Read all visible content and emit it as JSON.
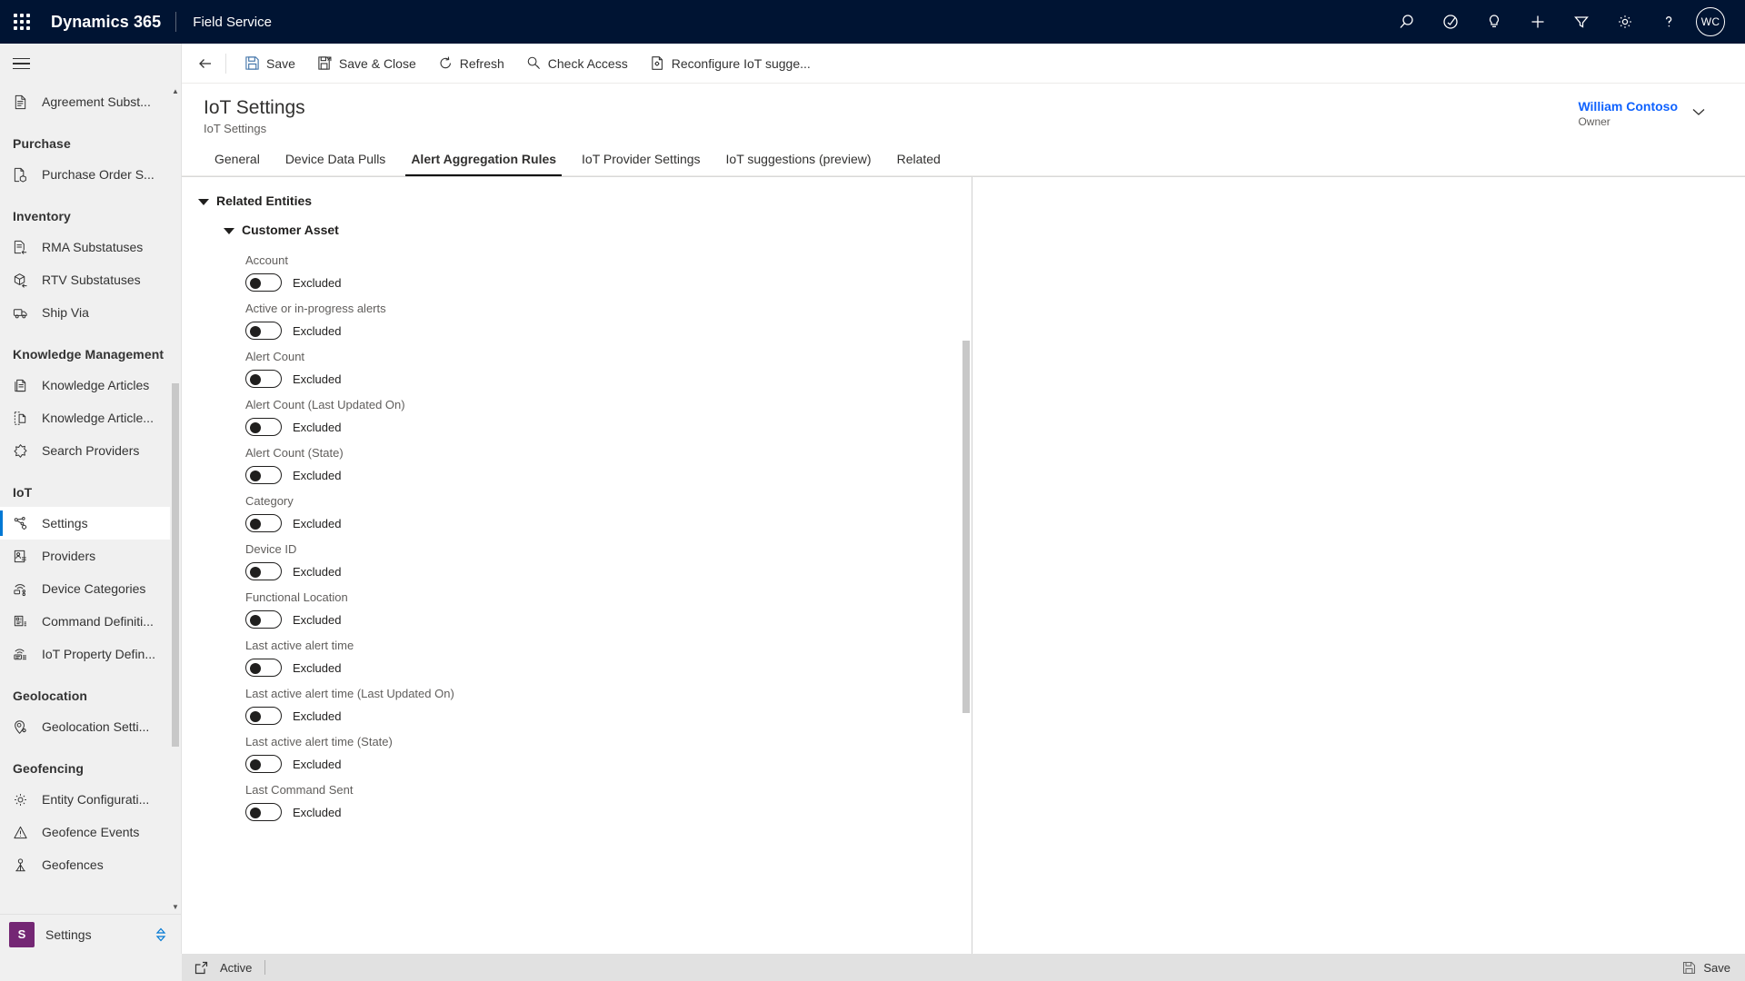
{
  "appbar": {
    "waffle_icon": "app-launcher-icon",
    "brand": "Dynamics 365",
    "app_name": "Field Service",
    "icons": [
      {
        "name": "search-icon",
        "label": "Search"
      },
      {
        "name": "assistant-icon",
        "label": "Assistant"
      },
      {
        "name": "lightbulb-icon",
        "label": "Insights"
      },
      {
        "name": "plus-icon",
        "label": "Quick create"
      },
      {
        "name": "filter-icon",
        "label": "Filter"
      },
      {
        "name": "gear-icon",
        "label": "Settings"
      },
      {
        "name": "help-icon",
        "label": "Help"
      }
    ],
    "avatar_initials": "WC"
  },
  "sidebar": {
    "hamburger_label": "Expand navigation",
    "groups": [
      {
        "title": "",
        "items": [
          {
            "label": "Agreement Subst...",
            "icon": "document-icon",
            "selected": false
          }
        ]
      },
      {
        "title": "Purchase",
        "items": [
          {
            "label": "Purchase Order S...",
            "icon": "purchase-order-icon",
            "selected": false
          }
        ]
      },
      {
        "title": "Inventory",
        "items": [
          {
            "label": "RMA Substatuses",
            "icon": "rma-icon",
            "selected": false
          },
          {
            "label": "RTV Substatuses",
            "icon": "rtv-icon",
            "selected": false
          },
          {
            "label": "Ship Via",
            "icon": "truck-icon",
            "selected": false
          }
        ]
      },
      {
        "title": "Knowledge Management",
        "items": [
          {
            "label": "Knowledge Articles",
            "icon": "knowledge-article-icon",
            "selected": false
          },
          {
            "label": "Knowledge Article...",
            "icon": "knowledge-template-icon",
            "selected": false
          },
          {
            "label": "Search Providers",
            "icon": "search-provider-icon",
            "selected": false
          }
        ]
      },
      {
        "title": "IoT",
        "items": [
          {
            "label": "Settings",
            "icon": "iot-settings-icon",
            "selected": true
          },
          {
            "label": "Providers",
            "icon": "iot-provider-icon",
            "selected": false
          },
          {
            "label": "Device Categories",
            "icon": "device-category-icon",
            "selected": false
          },
          {
            "label": "Command Definiti...",
            "icon": "command-definition-icon",
            "selected": false
          },
          {
            "label": "IoT Property Defin...",
            "icon": "iot-property-icon",
            "selected": false
          }
        ]
      },
      {
        "title": "Geolocation",
        "items": [
          {
            "label": "Geolocation Setti...",
            "icon": "geolocation-icon",
            "selected": false
          }
        ]
      },
      {
        "title": "Geofencing",
        "items": [
          {
            "label": "Entity Configurati...",
            "icon": "gear-icon",
            "selected": false
          },
          {
            "label": "Geofence Events",
            "icon": "warning-icon",
            "selected": false
          },
          {
            "label": "Geofences",
            "icon": "geofence-icon",
            "selected": false
          }
        ]
      }
    ],
    "footer": {
      "badge": "S",
      "label": "Settings",
      "chevron_icon": "area-switcher-icon"
    }
  },
  "commandbar": {
    "back_icon": "back-arrow-icon",
    "buttons": [
      {
        "label": "Save",
        "icon": "save-icon"
      },
      {
        "label": "Save & Close",
        "icon": "save-close-icon"
      },
      {
        "label": "Refresh",
        "icon": "refresh-icon"
      },
      {
        "label": "Check Access",
        "icon": "check-access-icon"
      },
      {
        "label": "Reconfigure IoT sugge...",
        "icon": "reconfigure-icon"
      }
    ]
  },
  "form_header": {
    "title": "IoT Settings",
    "subtitle": "IoT Settings",
    "owner_name": "William Contoso",
    "owner_role": "Owner",
    "chevron_icon": "chevron-down-icon"
  },
  "tabs": [
    {
      "label": "General",
      "active": false
    },
    {
      "label": "Device Data Pulls",
      "active": false
    },
    {
      "label": "Alert Aggregation Rules",
      "active": true
    },
    {
      "label": "IoT Provider Settings",
      "active": false
    },
    {
      "label": "IoT suggestions (preview)",
      "active": false
    },
    {
      "label": "Related",
      "active": false
    }
  ],
  "content": {
    "section_title": "Related Entities",
    "subsection_title": "Customer Asset",
    "fields": [
      {
        "label": "Account",
        "value": "Excluded",
        "on": false
      },
      {
        "label": "Active or in-progress alerts",
        "value": "Excluded",
        "on": false
      },
      {
        "label": "Alert Count",
        "value": "Excluded",
        "on": false
      },
      {
        "label": "Alert Count (Last Updated On)",
        "value": "Excluded",
        "on": false
      },
      {
        "label": "Alert Count (State)",
        "value": "Excluded",
        "on": false
      },
      {
        "label": "Category",
        "value": "Excluded",
        "on": false
      },
      {
        "label": "Device ID",
        "value": "Excluded",
        "on": false
      },
      {
        "label": "Functional Location",
        "value": "Excluded",
        "on": false
      },
      {
        "label": "Last active alert time",
        "value": "Excluded",
        "on": false
      },
      {
        "label": "Last active alert time (Last Updated On)",
        "value": "Excluded",
        "on": false
      },
      {
        "label": "Last active alert time (State)",
        "value": "Excluded",
        "on": false
      },
      {
        "label": "Last Command Sent",
        "value": "Excluded",
        "on": false
      }
    ]
  },
  "statusbar": {
    "popout_icon": "popout-icon",
    "status": "Active",
    "save_label": "Save",
    "save_icon": "save-icon"
  },
  "colors": {
    "appbar_bg": "#001433",
    "accent": "#0078d4",
    "link": "#0f62fe",
    "sidebar_bg": "#f0f0f0",
    "statusbar_bg": "#e1e1e1",
    "sitemap_badge": "#742774"
  }
}
